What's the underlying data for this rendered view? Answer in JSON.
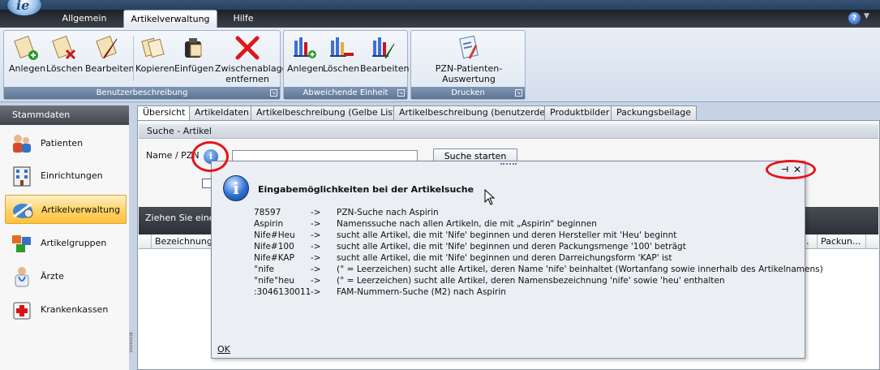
{
  "app": {
    "menu_tabs": [
      "Allgemein",
      "Artikelverwaltung",
      "Hilfe"
    ],
    "active_tab": "Artikelverwaltung",
    "help_glyph": "?",
    "logo_glyph": "ie"
  },
  "ribbon": {
    "groups": [
      {
        "label": "Benutzerbeschreibung",
        "buttons": [
          "Anlegen",
          "Löschen",
          "Bearbeiten",
          "Kopieren",
          "Einfügen",
          "Zwischenablage entfernen"
        ]
      },
      {
        "label": "Abweichende Einheit",
        "buttons": [
          "Anlegen",
          "Löschen",
          "Bearbeiten"
        ]
      },
      {
        "label": "Drucken",
        "buttons": [
          "PZN-Patienten-Auswertung"
        ]
      }
    ]
  },
  "sidebar": {
    "header": "Stammdaten",
    "items": [
      "Patienten",
      "Einrichtungen",
      "Artikelverwaltung",
      "Artikelgruppen",
      "Ärzte",
      "Krankenkassen"
    ],
    "active": "Artikelverwaltung"
  },
  "content": {
    "tabs": [
      "Übersicht",
      "Artikeldaten",
      "Artikelbeschreibung (Gelbe Liste)",
      "Artikelbeschreibung (benutzerdef.)",
      "Produktbilder",
      "Packungsbeilage"
    ],
    "active_tab": "Übersicht",
    "search_section_title": "Suche - Artikel",
    "name_label": "Name / PZN",
    "name_value": "",
    "search_button": "Suche starten",
    "grouping_hint": "Ziehen Sie eine Sp",
    "columns": [
      "Bezeichnung",
      ".",
      "Packun..."
    ]
  },
  "popup": {
    "title": "Eingabemöglichkeiten bei der Artikelsuche",
    "rows": [
      {
        "input": "78597",
        "arrow": "->",
        "desc": "PZN-Suche nach Aspirin"
      },
      {
        "input": "Aspirin",
        "arrow": "->",
        "desc": "Namenssuche nach allen Artikeln, die mit „Aspirin“ beginnen"
      },
      {
        "input": "Nife#Heu",
        "arrow": "->",
        "desc": "sucht alle Artikel, die mit 'Nife' beginnen und deren Hersteller mit 'Heu' beginnt"
      },
      {
        "input": "Nife#100",
        "arrow": "->",
        "desc": "sucht alle Artikel, die mit 'Nife' beginnen und deren Packungsmenge '100' beträgt"
      },
      {
        "input": "Nife#KAP",
        "arrow": "->",
        "desc": "sucht alle Artikel, die mit 'Nife' beginnen und deren Darreichungsform 'KAP' ist"
      },
      {
        "input": "°nife",
        "arrow": "->",
        "desc": "(° = Leerzeichen) sucht alle Artikel, deren Name 'nife' beinhaltet (Wortanfang sowie innerhalb des Artikelnamens)"
      },
      {
        "input": "°nife°heu",
        "arrow": "->",
        "desc": "(° = Leerzeichen) sucht alle Artikel, deren Namensbezeichnung 'nife' sowie 'heu' enthalten"
      },
      {
        "input": ":3046130011",
        "arrow": "->",
        "desc": "FAM-Nummern-Suche (M2) nach Aspirin"
      }
    ],
    "ok_label": "OK",
    "pin_glyph": "⊣",
    "close_glyph": "✕"
  },
  "colors": {
    "highlight_ring": "#e4141b",
    "sidebar_active": "#ffc23d",
    "ribbon_group_label": "#5e7594"
  }
}
